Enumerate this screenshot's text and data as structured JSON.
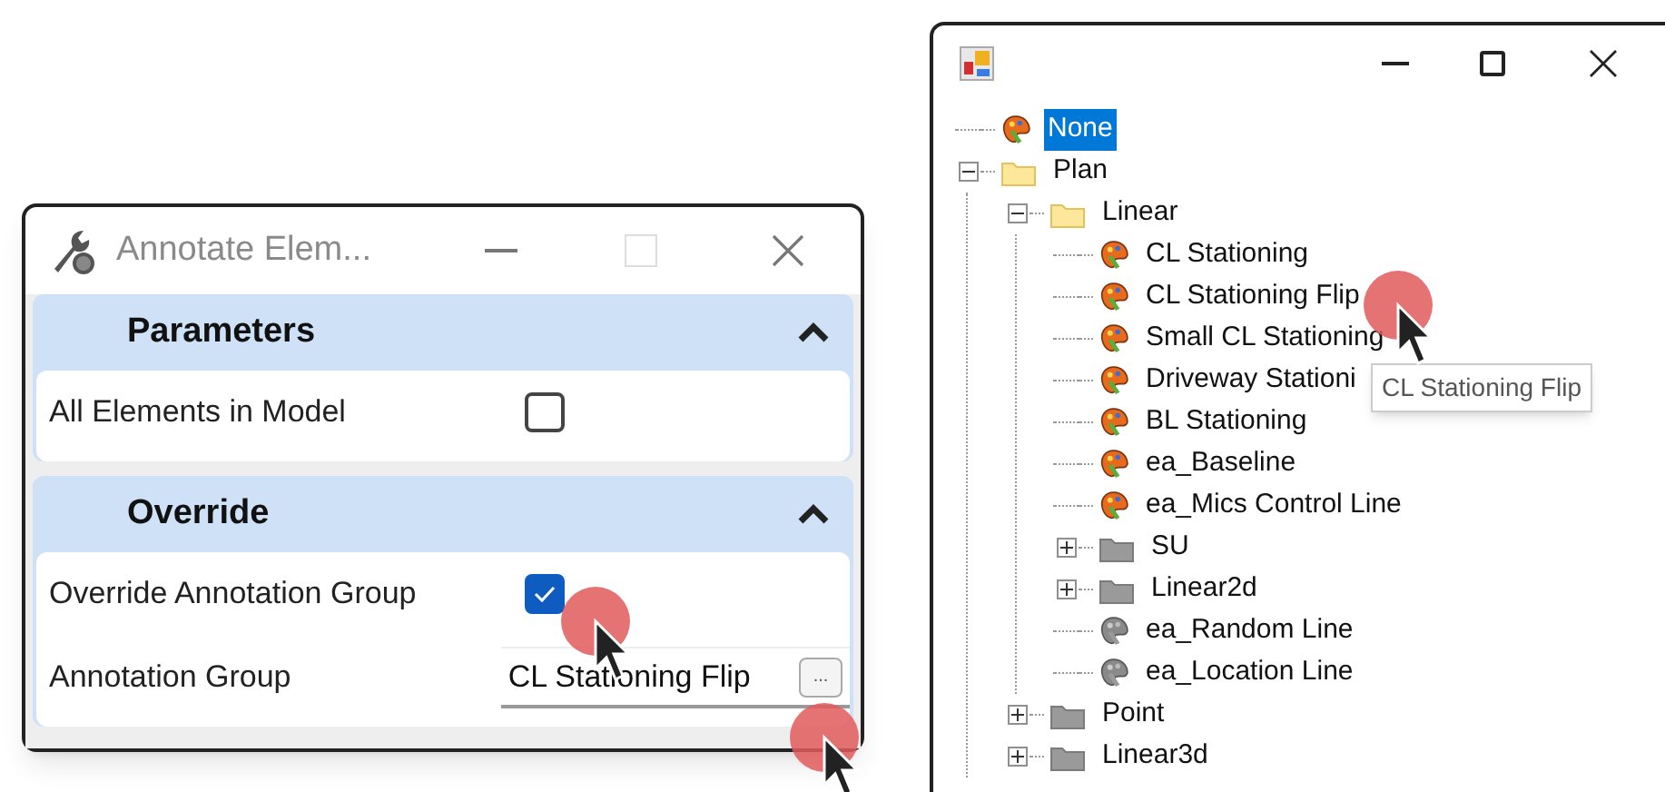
{
  "annotate_dialog": {
    "title": "Annotate Elem...",
    "sections": [
      {
        "title": "Parameters",
        "expanded": true,
        "rows": [
          {
            "kind": "checkbox",
            "label": "All Elements in Model",
            "checked": false
          }
        ]
      },
      {
        "title": "Override",
        "expanded": true,
        "rows": [
          {
            "kind": "checkbox",
            "label": "Override Annotation Group",
            "checked": true
          },
          {
            "kind": "field",
            "label": "Annotation Group",
            "value": "CL Stationing Flip",
            "button": "..."
          }
        ]
      }
    ]
  },
  "tree_window": {
    "tooltip": "CL Stationing Flip",
    "tree": [
      {
        "kind": "style",
        "label": "None",
        "available": true,
        "selected": true
      },
      {
        "kind": "folder",
        "label": "Plan",
        "expanded": true,
        "selected": false,
        "children": [
          {
            "kind": "folder",
            "label": "Linear",
            "expanded": true,
            "selected": false,
            "children": [
              {
                "kind": "style",
                "label": "CL Stationing",
                "available": true,
                "selected": false
              },
              {
                "kind": "style",
                "label": "CL Stationing Flip",
                "available": true,
                "selected": false
              },
              {
                "kind": "style",
                "label": "Small CL Stationing",
                "available": true,
                "selected": false
              },
              {
                "kind": "style",
                "label": "Driveway Stationi",
                "available": true,
                "selected": false
              },
              {
                "kind": "style",
                "label": "BL Stationing",
                "available": true,
                "selected": false
              },
              {
                "kind": "style",
                "label": "ea_Baseline",
                "available": true,
                "selected": false
              },
              {
                "kind": "style",
                "label": "ea_Mics Control Line",
                "available": true,
                "selected": false
              },
              {
                "kind": "folder",
                "label": "SU",
                "expanded": false,
                "selected": false
              },
              {
                "kind": "folder",
                "label": "Linear2d",
                "expanded": false,
                "selected": false
              },
              {
                "kind": "style",
                "label": "ea_Random Line",
                "available": false,
                "selected": false
              },
              {
                "kind": "style",
                "label": "ea_Location Line",
                "available": false,
                "selected": false
              }
            ]
          },
          {
            "kind": "folder",
            "label": "Point",
            "expanded": false,
            "selected": false
          },
          {
            "kind": "folder",
            "label": "Linear3d",
            "expanded": false,
            "selected": false
          }
        ]
      }
    ]
  }
}
